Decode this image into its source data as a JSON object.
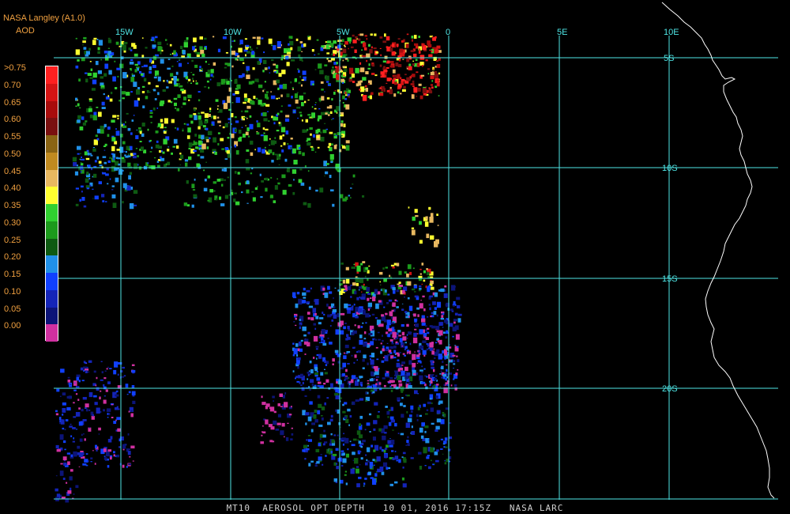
{
  "header": {
    "source": "NASA Langley (A1.0)",
    "variable": "AOD"
  },
  "legend": {
    "items": [
      {
        "label": ">0.75",
        "color": "#ff2020"
      },
      {
        "label": "0.70",
        "color": "#d41414"
      },
      {
        "label": "0.65",
        "color": "#a80c0c"
      },
      {
        "label": "0.60",
        "color": "#7a1010"
      },
      {
        "label": "0.55",
        "color": "#8a6414"
      },
      {
        "label": "0.50",
        "color": "#c08a20"
      },
      {
        "label": "0.45",
        "color": "#e8b860"
      },
      {
        "label": "0.40",
        "color": "#ffff30"
      },
      {
        "label": "0.35",
        "color": "#30d030"
      },
      {
        "label": "0.30",
        "color": "#1c9a1c"
      },
      {
        "label": "0.25",
        "color": "#0e5a12"
      },
      {
        "label": "0.20",
        "color": "#2090e8"
      },
      {
        "label": "0.15",
        "color": "#1040ff"
      },
      {
        "label": "0.10",
        "color": "#1424b8"
      },
      {
        "label": "0.05",
        "color": "#0c1478"
      },
      {
        "label": "0.00",
        "color": "#d030a0"
      }
    ]
  },
  "map": {
    "longitude_labels": [
      "15W",
      "10W",
      "5W",
      "0",
      "5E",
      "10E"
    ],
    "latitude_labels": [
      "5S",
      "10S",
      "15S",
      "20S"
    ],
    "gridline_color": "#4fe6e6",
    "coastline_color": "#ffffff"
  },
  "footer": {
    "text": "MT10  AEROSOL OPT DEPTH   10 01, 2016 17:15Z   NASA LARC"
  }
}
